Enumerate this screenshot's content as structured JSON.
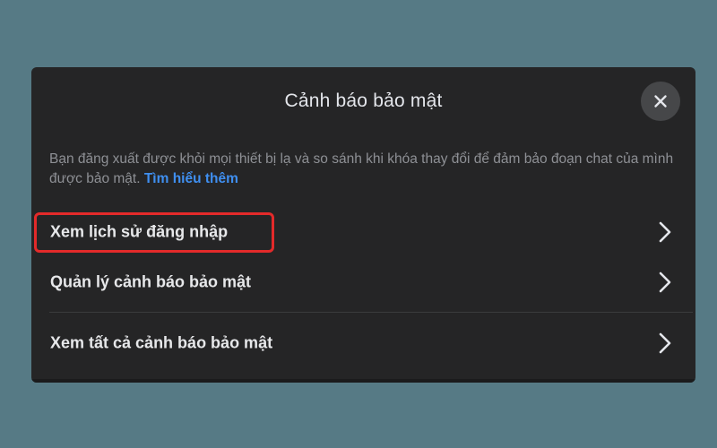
{
  "dialog": {
    "title": "Cảnh báo bảo mật",
    "close_icon": "close-icon",
    "description": "Bạn đăng xuất được khỏi mọi thiết bị lạ và so sánh khi khóa thay đổi để đảm bảo đoạn chat của mình được bảo mật.",
    "learn_more": "Tìm hiểu thêm",
    "items": [
      {
        "label": "Xem lịch sử đăng nhập",
        "icon": "chevron-right-icon",
        "highlighted": true
      },
      {
        "label": "Quản lý cảnh báo bảo mật",
        "icon": "chevron-right-icon",
        "highlighted": false
      },
      {
        "label": "Xem tất cả cảnh báo bảo mật",
        "icon": "chevron-right-icon",
        "highlighted": false
      }
    ]
  },
  "colors": {
    "page_background": "#567a85",
    "dialog_background": "#252526",
    "link": "#3f8ff0",
    "highlight_outline": "#e32a2a"
  }
}
